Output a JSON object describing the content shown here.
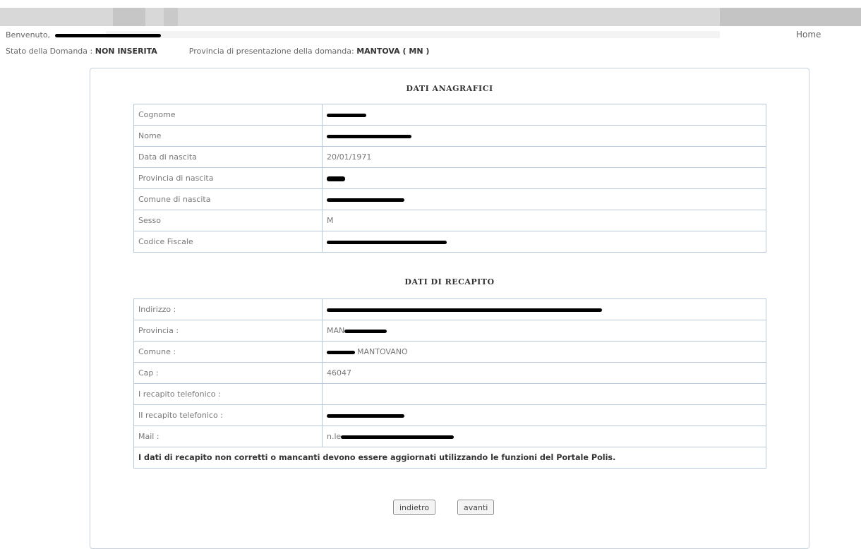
{
  "header": {
    "welcome_label": "Benvenuto,",
    "home_link": "Home",
    "status_label": "Stato della Domanda :",
    "status_value": "NON INSERITA",
    "province_label": "Provincia di presentazione della domanda:",
    "province_value": "MANTOVA ( MN )"
  },
  "anagrafici": {
    "title": "DATI ANAGRAFICI",
    "rows": [
      {
        "label": "Cognome",
        "value": ""
      },
      {
        "label": "Nome",
        "value": ""
      },
      {
        "label": "Data di nascita",
        "value": "20/01/1971"
      },
      {
        "label": "Provincia di nascita",
        "value": ""
      },
      {
        "label": "Comune di nascita",
        "value": ""
      },
      {
        "label": "Sesso",
        "value": "M"
      },
      {
        "label": "Codice Fiscale",
        "value": ""
      }
    ]
  },
  "recapito": {
    "title": "DATI DI RECAPITO",
    "rows": [
      {
        "label": "Indirizzo :",
        "value": ""
      },
      {
        "label": "Provincia :",
        "value": "MAN"
      },
      {
        "label": "Comune :",
        "value": "MANTOVANO"
      },
      {
        "label": "Cap :",
        "value": "46047"
      },
      {
        "label": "I recapito telefonico :",
        "value": ""
      },
      {
        "label": "II recapito telefonico :",
        "value": ""
      },
      {
        "label": "Mail :",
        "value": "n.le"
      }
    ],
    "note": "I dati di recapito non corretti o mancanti devono essere aggiornati utilizzando le funzioni del Portale Polis."
  },
  "buttons": {
    "back": "indietro",
    "next": "avanti"
  }
}
